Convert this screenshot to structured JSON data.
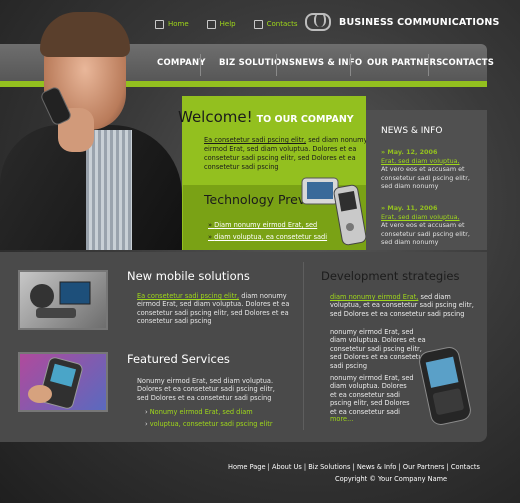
{
  "top_links": [
    {
      "label": "Home"
    },
    {
      "label": "Help"
    },
    {
      "label": "Contacts"
    }
  ],
  "brand": {
    "name": "BUSINESS COMMUNICATIONS"
  },
  "nav": [
    {
      "label": "COMPANY"
    },
    {
      "label": "BIZ SOLUTIONS"
    },
    {
      "label": "NEWS & INFO"
    },
    {
      "label": "OUR PARTNERS"
    },
    {
      "label": "CONTACTS"
    }
  ],
  "welcome": {
    "title": "Welcome!",
    "subtitle": "TO OUR COMPANY",
    "link": "Ea consetetur sadi pscing elitr,",
    "text": " sed diam nonumy eirmod Erat, sed diam voluptua. Dolores et ea consetetur sadi pscing elitr, sed Dolores et ea consetetur sadi pscing"
  },
  "tech": {
    "title": "Technology Preview",
    "items": [
      "Diam nonumy eirmod Erat, sed",
      "diam voluptua, ea consetetur sadi"
    ]
  },
  "news": {
    "title": "NEWS & INFO",
    "items": [
      {
        "date": "May. 12, 2006",
        "link": "Erat, sed diam voluptua,",
        "text": "At vero eos et accusam et consetetur sadi pscing elitr, sed diam nonumy"
      },
      {
        "date": "May. 11, 2006",
        "link": "Erat, sed diam voluptua,",
        "text": "At vero eos et accusam et consetetur sadi pscing elitr, sed diam nonumy"
      }
    ]
  },
  "mobile": {
    "title": "New mobile solutions",
    "link": "Ea consetetur sadi pscing elitr,",
    "text": " diam nonumy eirmod Erat, sed diam voluptua. Dolores et ea consetetur sadi pscing elitr, sed Dolores et ea consetetur sadi pscing"
  },
  "featured": {
    "title": "Featured Services",
    "text": "Nonumy eirmod Erat, sed diam voluptua. Dolores et ea consetetur sadi pscing elitr, sed Dolores et ea consetetur sadi pscing",
    "items": [
      "Nonumy eirmod Erat, sed diam",
      "voluptua, consetetur sadi pscing elitr"
    ]
  },
  "dev": {
    "title": "Development strategies",
    "p1_link": "diam nonumy eirmod Erat,",
    "p1": " sed diam voluptua, et ea consetetur sadi pscing elitr, sed Dolores et ea consetetur sadi pscing",
    "p2": "nonumy eirmod Erat, sed diam voluptua. Dolores et ea consetetur sadi pscing elitr, sed Dolores et ea consetetur sadi pscing",
    "p3": "nonumy eirmod Erat, sed diam voluptua. Dolores et ea consetetur sadi pscing elitr, sed Dolores et ea consetetur sadi",
    "more": "more..."
  },
  "footer": {
    "links": "Home Page | About Us | Biz Solutions | News & Info | Our Partners | Contacts",
    "copyright": "Copyright © Your Company Name"
  },
  "colors": {
    "accent": "#93c01f",
    "accent_dark": "#7aa215",
    "panel": "#4a4a4a"
  }
}
